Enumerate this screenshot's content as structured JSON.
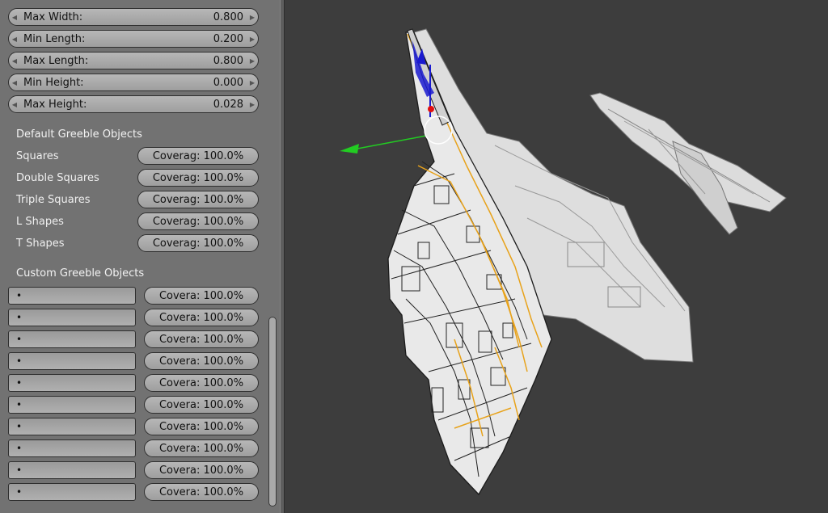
{
  "panel": {
    "params": [
      {
        "label": "Max Width:",
        "value": "0.800"
      },
      {
        "label": "Min Length:",
        "value": "0.200"
      },
      {
        "label": "Max Length:",
        "value": "0.800"
      },
      {
        "label": "Min Height:",
        "value": "0.000"
      },
      {
        "label": "Max Height:",
        "value": "0.028"
      }
    ],
    "default_section": "Default Greeble Objects",
    "default_items": [
      {
        "label": "Squares",
        "coverage": "Coverag: 100.0%"
      },
      {
        "label": "Double Squares",
        "coverage": "Coverag: 100.0%"
      },
      {
        "label": "Triple Squares",
        "coverage": "Coverag: 100.0%"
      },
      {
        "label": "L Shapes",
        "coverage": "Coverag: 100.0%"
      },
      {
        "label": "T Shapes",
        "coverage": "Coverag: 100.0%"
      }
    ],
    "custom_section": "Custom Greeble Objects",
    "custom_items": [
      {
        "field": "•",
        "coverage": "Covera: 100.0%"
      },
      {
        "field": "•",
        "coverage": "Covera: 100.0%"
      },
      {
        "field": "•",
        "coverage": "Covera: 100.0%"
      },
      {
        "field": "•",
        "coverage": "Covera: 100.0%"
      },
      {
        "field": "•",
        "coverage": "Covera: 100.0%"
      },
      {
        "field": "•",
        "coverage": "Covera: 100.0%"
      },
      {
        "field": "•",
        "coverage": "Covera: 100.0%"
      },
      {
        "field": "•",
        "coverage": "Covera: 100.0%"
      },
      {
        "field": "•",
        "coverage": "Covera: 100.0%"
      },
      {
        "field": "•",
        "coverage": "Covera: 100.0%"
      }
    ]
  },
  "viewport": {
    "background": "#3d3d3d",
    "manipulator": {
      "x_axis_color": "#e01010",
      "y_axis_color": "#22cc22",
      "z_axis_color": "#1a1ad0"
    },
    "selection_outline_color": "#e8a21a",
    "model_color": "#e8e8e8"
  }
}
